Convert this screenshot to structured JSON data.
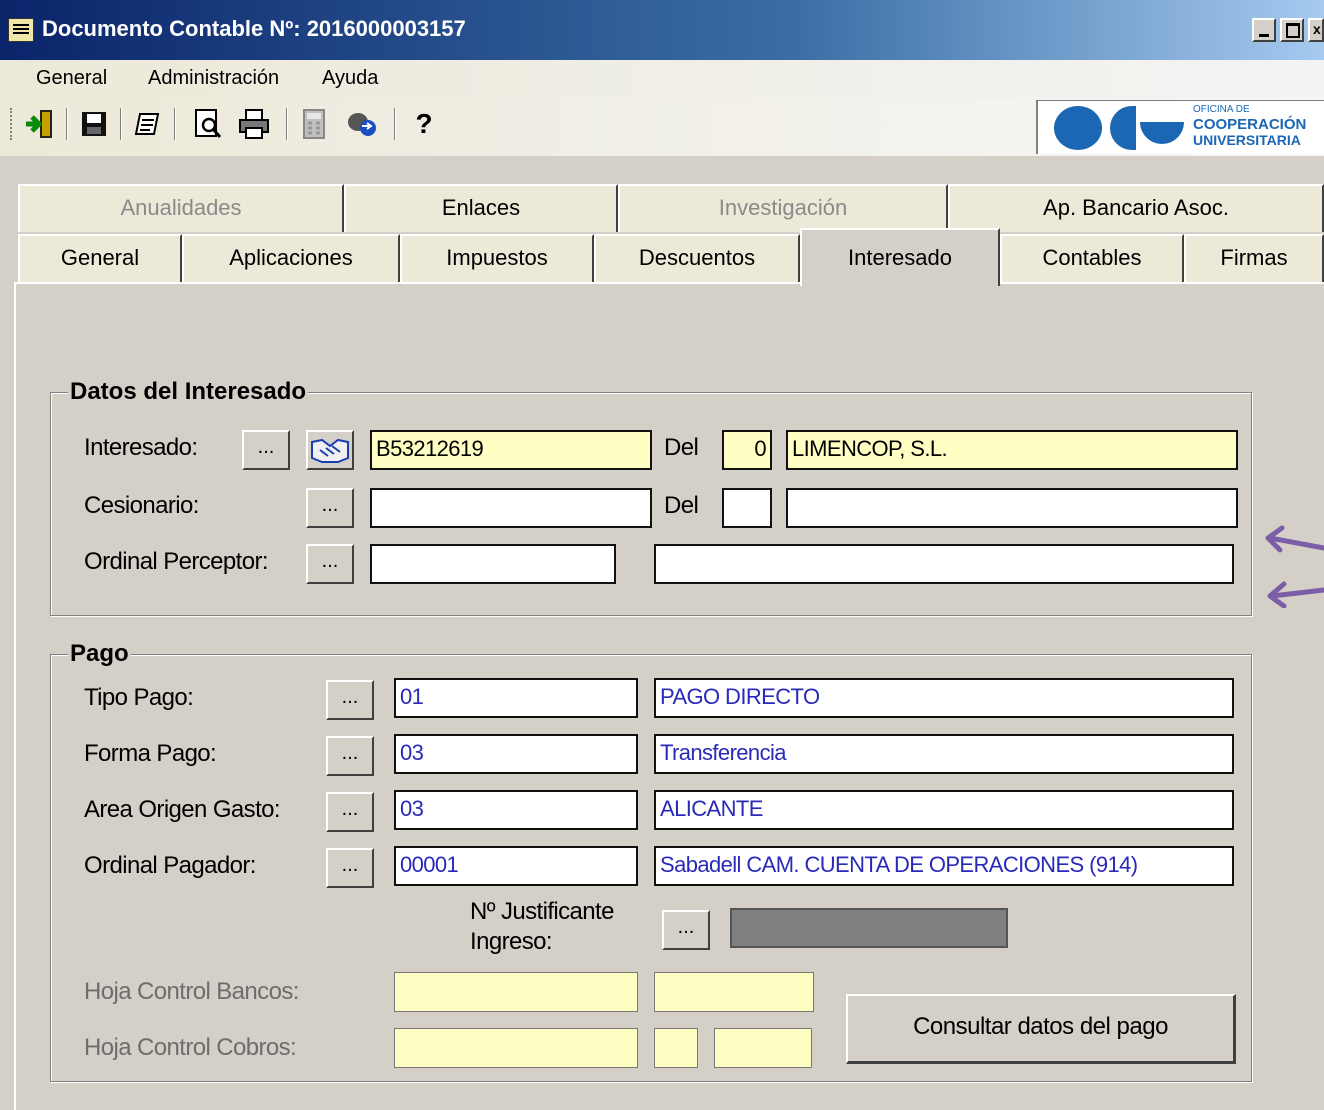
{
  "window": {
    "title": "Documento Contable Nº: 2016000003157",
    "close_glyph": "x"
  },
  "menu": {
    "items": [
      "General",
      "Administración",
      "Ayuda"
    ]
  },
  "toolbar": {
    "help_glyph": "?",
    "logo": {
      "line1": "OFICINA DE",
      "line2": "COOPERACIÓN",
      "line3": "UNIVERSITARIA",
      "color": "#1c67b4"
    }
  },
  "tabs": {
    "row1": [
      "Anualidades",
      "Enlaces",
      "Investigación",
      "Ap. Bancario Asoc."
    ],
    "row2": [
      "General",
      "Aplicaciones",
      "Impuestos",
      "Descuentos",
      "Interesado",
      "Contables",
      "Firmas"
    ],
    "active": "Interesado"
  },
  "interesado_group": {
    "title": "Datos del Interesado",
    "interesado": {
      "label": "Interesado:",
      "dots": "...",
      "code": "B53212619",
      "del_label": "Del",
      "del_value": "0",
      "name": "LIMENCOP, S.L."
    },
    "cesionario": {
      "label": "Cesionario:",
      "dots": "...",
      "code": "",
      "del_label": "Del",
      "del_value": "",
      "name": ""
    },
    "ordinal": {
      "label": "Ordinal Perceptor:",
      "dots": "...",
      "code": "",
      "name": ""
    }
  },
  "pago_group": {
    "title": "Pago",
    "tipo_pago": {
      "label": "Tipo Pago:",
      "dots": "...",
      "code": "01",
      "desc": "PAGO DIRECTO"
    },
    "forma_pago": {
      "label": "Forma Pago:",
      "dots": "...",
      "code": "03",
      "desc": "Transferencia"
    },
    "area_origen": {
      "label": "Area Origen Gasto:",
      "dots": "...",
      "code": "03",
      "desc": "ALICANTE"
    },
    "ordinal_pagador": {
      "label": "Ordinal Pagador:",
      "dots": "...",
      "code": "00001",
      "desc": "Sabadell CAM. CUENTA DE OPERACIONES (914)"
    },
    "justificante": {
      "label_line1": "Nº Justificante",
      "label_line2": "Ingreso:",
      "dots": "...",
      "value": ""
    },
    "hoja_bancos": {
      "label": "Hoja Control Bancos:",
      "value1": "",
      "value2": ""
    },
    "hoja_cobros": {
      "label": "Hoja Control Cobros:",
      "value1": "",
      "value2": "",
      "value3": ""
    },
    "consultar_button": "Consultar datos del pago"
  },
  "colors": {
    "annotation_arrow": "#7b5ea7",
    "field_highlight": "#ffffc4",
    "field_blue_text": "#2a2ab8"
  }
}
